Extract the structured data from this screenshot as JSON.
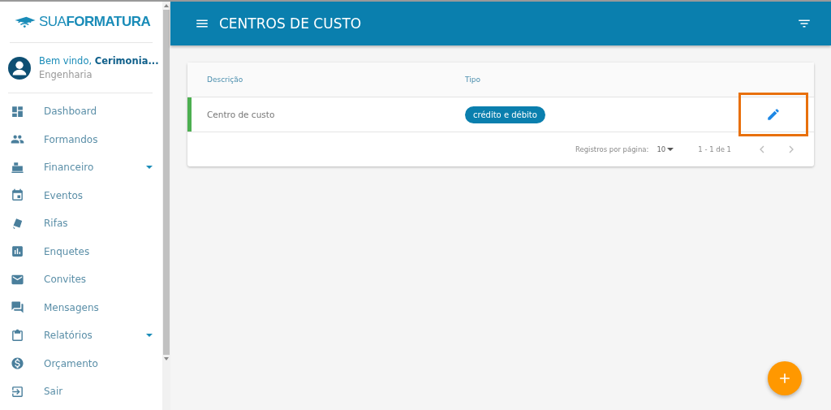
{
  "sidebar": {
    "logo": {
      "text_light": "SUA",
      "text_bold": "FORMATURA"
    },
    "user": {
      "greeting": "Bem vindo,",
      "name": "Cerimonia...",
      "subtitle": "Engenharia"
    },
    "items": [
      {
        "label": "Dashboard",
        "submenu": false
      },
      {
        "label": "Formandos",
        "submenu": false
      },
      {
        "label": "Financeiro",
        "submenu": true
      },
      {
        "label": "Eventos",
        "submenu": false
      },
      {
        "label": "Rifas",
        "submenu": false
      },
      {
        "label": "Enquetes",
        "submenu": false
      },
      {
        "label": "Convites",
        "submenu": false
      },
      {
        "label": "Mensagens",
        "submenu": false
      },
      {
        "label": "Relatórios",
        "submenu": true
      },
      {
        "label": "Orçamento",
        "submenu": false
      },
      {
        "label": "Sair",
        "submenu": false
      }
    ]
  },
  "header": {
    "title": "CENTROS DE CUSTO"
  },
  "table": {
    "columns": [
      "Descrição",
      "Tipo"
    ],
    "rows": [
      {
        "descricao": "Centro de custo",
        "tipo": "crédito e débito",
        "color": "#4caf50",
        "edit_highlighted": true
      }
    ],
    "footer": {
      "rows_per_page_label": "Registros por página:",
      "rows_per_page": "10",
      "range": "1 - 1 de 1"
    }
  }
}
